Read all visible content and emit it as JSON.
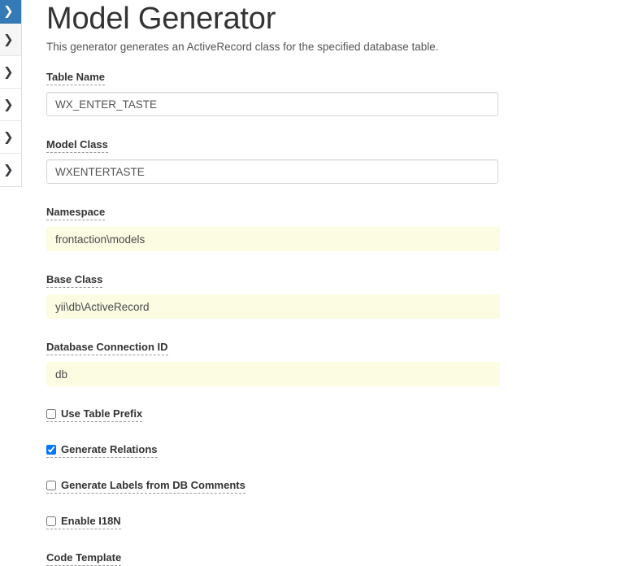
{
  "sidebar": {
    "items": [
      {
        "name": "nav-item-1",
        "icon": "chevron-right-icon",
        "active": true
      },
      {
        "name": "nav-item-2",
        "icon": "chevron-right-icon",
        "active": false
      },
      {
        "name": "nav-item-3",
        "icon": "chevron-right-icon",
        "active": false
      },
      {
        "name": "nav-item-4",
        "icon": "chevron-right-icon",
        "active": false
      },
      {
        "name": "nav-item-5",
        "icon": "chevron-right-icon",
        "active": false
      },
      {
        "name": "nav-item-6",
        "icon": "chevron-right-icon",
        "active": false
      }
    ],
    "chevron_glyph": "❯",
    "active_color": "#337ab7"
  },
  "main": {
    "title": "Model Generator",
    "description": "This generator generates an ActiveRecord class for the specified database table.",
    "fields": [
      {
        "label": "Table Name",
        "value": "WX_ENTER_TASTE",
        "style": "input"
      },
      {
        "label": "Model Class",
        "value": "WXENTERTASTE",
        "style": "input"
      },
      {
        "label": "Namespace",
        "value": "frontaction\\models",
        "style": "autofill"
      },
      {
        "label": "Base Class",
        "value": "yii\\db\\ActiveRecord",
        "style": "autofill"
      },
      {
        "label": "Database Connection ID",
        "value": "db",
        "style": "autofill"
      }
    ],
    "checkboxes": [
      {
        "label": "Use Table Prefix",
        "checked": false
      },
      {
        "label": "Generate Relations",
        "checked": true
      },
      {
        "label": "Generate Labels from DB Comments",
        "checked": false
      },
      {
        "label": "Enable I18N",
        "checked": false
      }
    ],
    "trailing_label": "Code Template",
    "autofill_color": "#fcfce3"
  }
}
